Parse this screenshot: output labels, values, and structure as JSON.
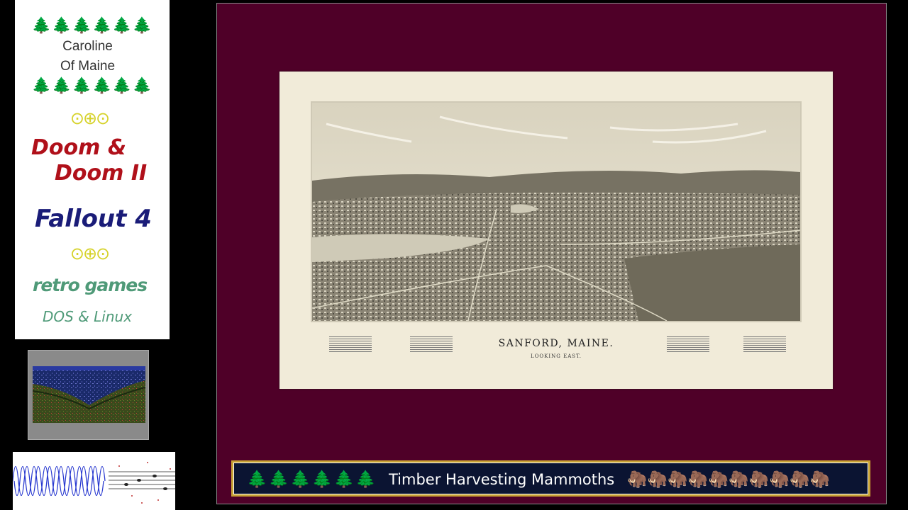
{
  "sidebar": {
    "trees_top": "🌲🌲🌲🌲🌲🌲",
    "name_line1": "Caroline",
    "name_line2": "Of Maine",
    "trees_bottom": "🌲🌲🌲🌲🌲🌲",
    "rings_top": "⊙⊕⊙",
    "doom_line1": "Doom &",
    "doom_line2": "Doom II",
    "fallout": "Fallout 4",
    "rings_bottom": "⊙⊕⊙",
    "retro": "retro games",
    "dos_linux": "DOS & Linux"
  },
  "map": {
    "title": "SANFORD, MAINE.",
    "subtitle": "LOOKING EAST."
  },
  "ticker": {
    "trees": "🌲🌲🌲🌲🌲🌲",
    "text": "Timber Harvesting Mammoths",
    "mammoths": "🦣🦣🦣🦣🦣🦣🦣🦣🦣🦣"
  },
  "colors": {
    "frame_bg": "#4f0028",
    "ticker_bg": "#0b1432",
    "ticker_border": "#c8a234",
    "doom_red": "#b0101a",
    "fallout_blue": "#1a1c78",
    "retro_green": "#4f9a78",
    "ring_yellow": "#d6d22a"
  }
}
